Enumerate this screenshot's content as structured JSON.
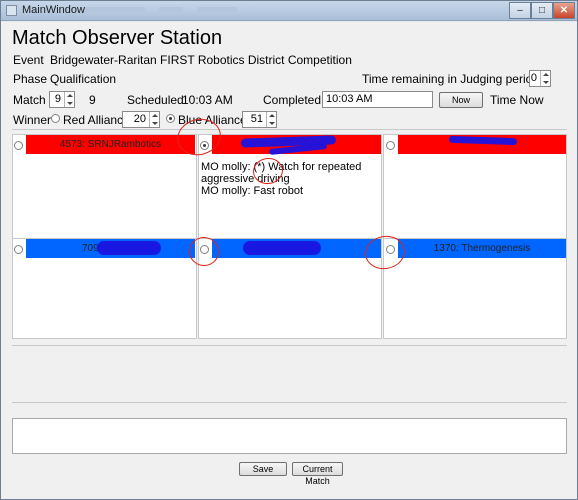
{
  "window": {
    "title": "MainWindow",
    "min": "–",
    "max": "□",
    "close": "✕"
  },
  "heading": "Match Observer Station",
  "event": {
    "label": "Event",
    "value": "Bridgewater-Raritan FIRST Robotics District Competition"
  },
  "phase": {
    "label": "Phase",
    "value": "Qualification"
  },
  "judging": {
    "label": "Time remaining in Judging period:",
    "value": "0"
  },
  "match": {
    "label": "Match",
    "number": "9",
    "number_display": "9",
    "scheduled_label": "Scheduled:",
    "scheduled_value": "10:03 AM",
    "completed_label": "Completed:",
    "completed_value": "10:03 AM",
    "now_button": "Now",
    "time_now_label": "Time Now"
  },
  "winner": {
    "label": "Winner",
    "red_label": "Red Alliance",
    "red_score": "20",
    "red_selected": false,
    "blue_label": "Blue Alliance",
    "blue_score": "51",
    "blue_selected": true
  },
  "colors": {
    "red": "#ff0000",
    "blue": "#0066ff",
    "annotation_red": "#d9241c",
    "redaction": "#1a14e0"
  },
  "red_teams": [
    {
      "name": "4573: SRNJRambotics",
      "selected": false
    },
    {
      "name": "",
      "selected": true
    },
    {
      "name": "",
      "selected": false
    }
  ],
  "notes": {
    "line1": "MO molly: (*) Watch for repeated",
    "line2": "aggressive driving",
    "line3": "MO molly: Fast robot"
  },
  "blue_teams": [
    {
      "name": "709:",
      "selected": false
    },
    {
      "name": "",
      "selected": false
    },
    {
      "name": "1370: Thermogenesis",
      "selected": false
    }
  ],
  "bottom": {
    "save": "Save",
    "current_match": "Current Match"
  }
}
